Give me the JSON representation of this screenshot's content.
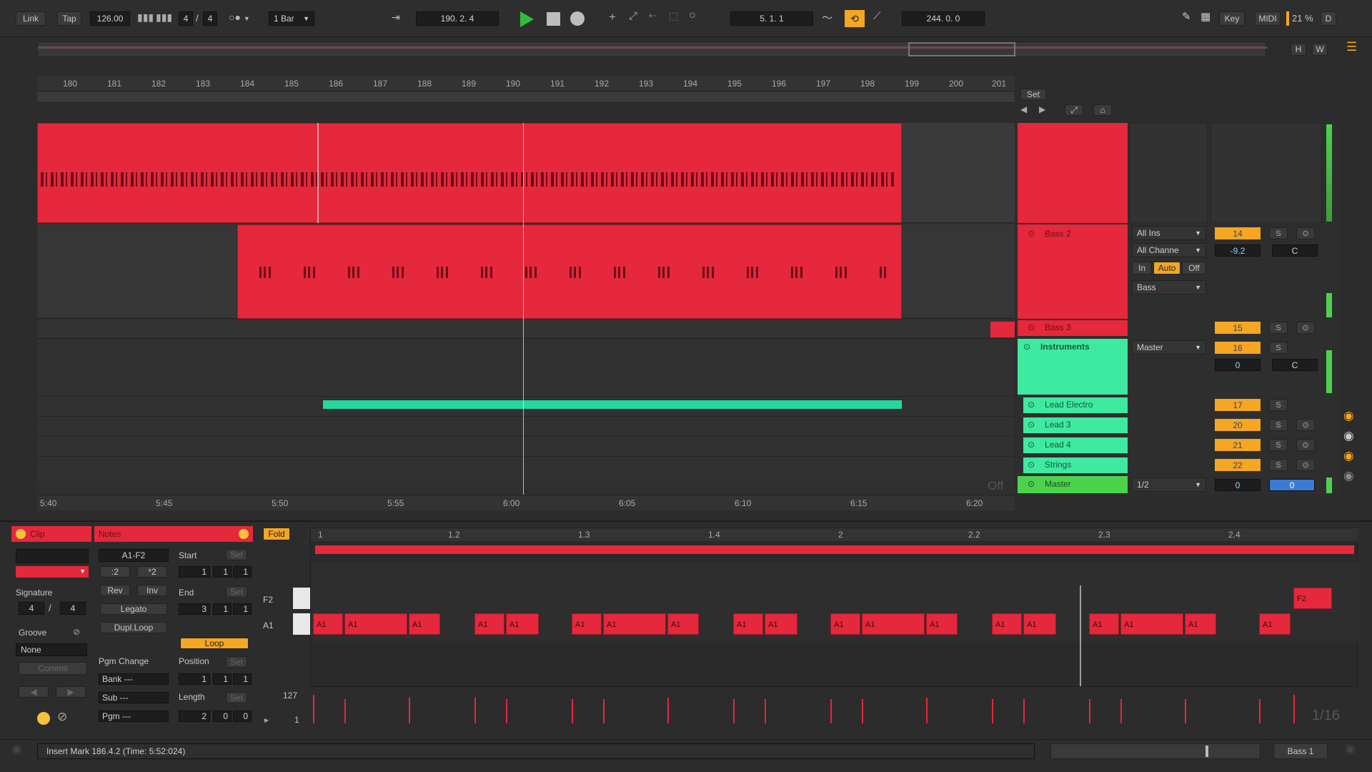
{
  "transport": {
    "link": "Link",
    "tap": "Tap",
    "tempo": "126.00",
    "time_sig_num": "4",
    "time_sig_den": "4",
    "quantize": "1 Bar",
    "arrangement_position": "190.  2.  4",
    "loop_start": "5.  1.  1",
    "loop_length": "244.  0.  0",
    "key": "Key",
    "midi": "MIDI",
    "cpu": "21 %",
    "d": "D"
  },
  "overview": {
    "h": "H",
    "w": "W"
  },
  "ruler": {
    "bars": [
      "180",
      "181",
      "182",
      "183",
      "184",
      "185",
      "186",
      "187",
      "188",
      "189",
      "190",
      "191",
      "192",
      "193",
      "194",
      "195",
      "196",
      "197",
      "198",
      "199",
      "200",
      "201"
    ],
    "set_label": "Set",
    "times": [
      "5:40",
      "5:45",
      "5:50",
      "5:55",
      "6:00",
      "6:05",
      "6:10",
      "6:15",
      "6:20"
    ]
  },
  "tracks": [
    {
      "name": "Bass 2",
      "input": "All Ins",
      "channel": "All Channe",
      "monitor": [
        "In",
        "Auto",
        "Off"
      ],
      "output": "Bass",
      "number": "14",
      "vol": "-9.2",
      "pan": "C",
      "solo": "S"
    },
    {
      "name": "Bass 3",
      "number": "15",
      "solo": "S"
    },
    {
      "name": "Instruments",
      "output": "Master",
      "number": "16",
      "vol": "0",
      "pan": "C",
      "solo": "S"
    },
    {
      "name": "Lead Electro",
      "number": "17",
      "solo": "S"
    },
    {
      "name": "Lead 3",
      "number": "20",
      "solo": "S"
    },
    {
      "name": "Lead 4",
      "number": "21",
      "solo": "S"
    },
    {
      "name": "Strings",
      "number": "22",
      "solo": "S"
    },
    {
      "name": "Master",
      "output": "1/2",
      "vol": "0",
      "pan": "0"
    }
  ],
  "off_label": "Off",
  "clip_panel": {
    "clip_title": "Clip",
    "notes_title": "Notes",
    "range": "A1-F2",
    "start": "Start",
    "set": "Set",
    "div2": ":2",
    "mul2": "*2",
    "rev": "Rev",
    "inv": "Inv",
    "legato": "Legato",
    "dupl_loop": "Dupl.Loop",
    "end": "End",
    "loop": "Loop",
    "signature": "Signature",
    "sig_num": "4",
    "sig_den": "4",
    "groove": "Groove",
    "groove_value": "None",
    "commit": "Commit",
    "pgm_change": "Pgm Change",
    "position": "Position",
    "bank": "Bank ---",
    "sub": "Sub ---",
    "pgm": "Pgm ---",
    "length": "Length",
    "start_vals": [
      "1",
      "1",
      "1"
    ],
    "end_vals": [
      "3",
      "1",
      "1"
    ],
    "position_vals": [
      "1",
      "1",
      "1"
    ],
    "length_vals": [
      "2",
      "0",
      "0"
    ]
  },
  "note_editor": {
    "fold": "Fold",
    "ruler": [
      "1",
      "1.2",
      "1.3",
      "1.4",
      "2",
      "2.2",
      "2.3",
      "2.4"
    ],
    "key_f2": "F2",
    "key_a1": "A1",
    "vel_max": "127",
    "vel_min": "1",
    "grid": "1/16"
  },
  "status": {
    "message": "Insert Mark 186.4.2 (Time: 5:52:024)",
    "track_label": "Bass 1"
  },
  "colors": {
    "clip_red": "#e5283b",
    "group_mint": "#3ee9a0",
    "accent_orange": "#f5a623",
    "play_green": "#2dbe3c",
    "master_green": "#4cd34c"
  }
}
